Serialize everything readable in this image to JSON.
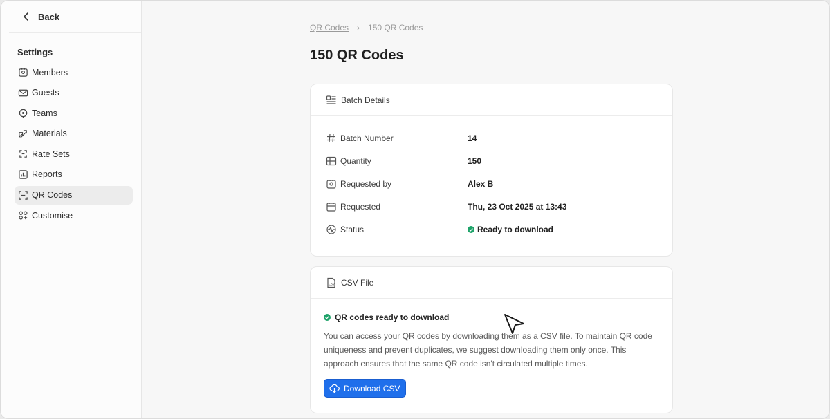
{
  "sidebar": {
    "back_label": "Back",
    "section_title": "Settings",
    "items": [
      {
        "label": "Members",
        "icon": "members-icon"
      },
      {
        "label": "Guests",
        "icon": "mail-icon"
      },
      {
        "label": "Teams",
        "icon": "teams-icon"
      },
      {
        "label": "Materials",
        "icon": "materials-icon"
      },
      {
        "label": "Rate Sets",
        "icon": "rate-sets-icon"
      },
      {
        "label": "Reports",
        "icon": "reports-icon"
      },
      {
        "label": "QR Codes",
        "icon": "qr-code-icon",
        "active": true
      },
      {
        "label": "Customise",
        "icon": "customise-icon"
      }
    ]
  },
  "breadcrumb": {
    "parent": "QR Codes",
    "separator": "›",
    "current": "150 QR Codes"
  },
  "page_title": "150 QR Codes",
  "batch_card": {
    "title": "Batch Details",
    "rows": [
      {
        "label": "Batch Number",
        "value": "14"
      },
      {
        "label": "Quantity",
        "value": "150"
      },
      {
        "label": "Requested by",
        "value": "Alex B"
      },
      {
        "label": "Requested",
        "value": "Thu, 23 Oct 2025 at 13:43"
      },
      {
        "label": "Status",
        "value": "Ready to download"
      }
    ]
  },
  "csv_card": {
    "title": "CSV File",
    "ready_text": "QR codes ready to download",
    "description": "You can access your QR codes by downloading them as a CSV file. To maintain QR code uniqueness and prevent duplicates, we suggest downloading them only once. This approach ensures that the same QR code isn't circulated multiple times.",
    "button_label": "Download CSV"
  },
  "colors": {
    "accent": "#1f6feb",
    "success": "#1fa36a"
  }
}
